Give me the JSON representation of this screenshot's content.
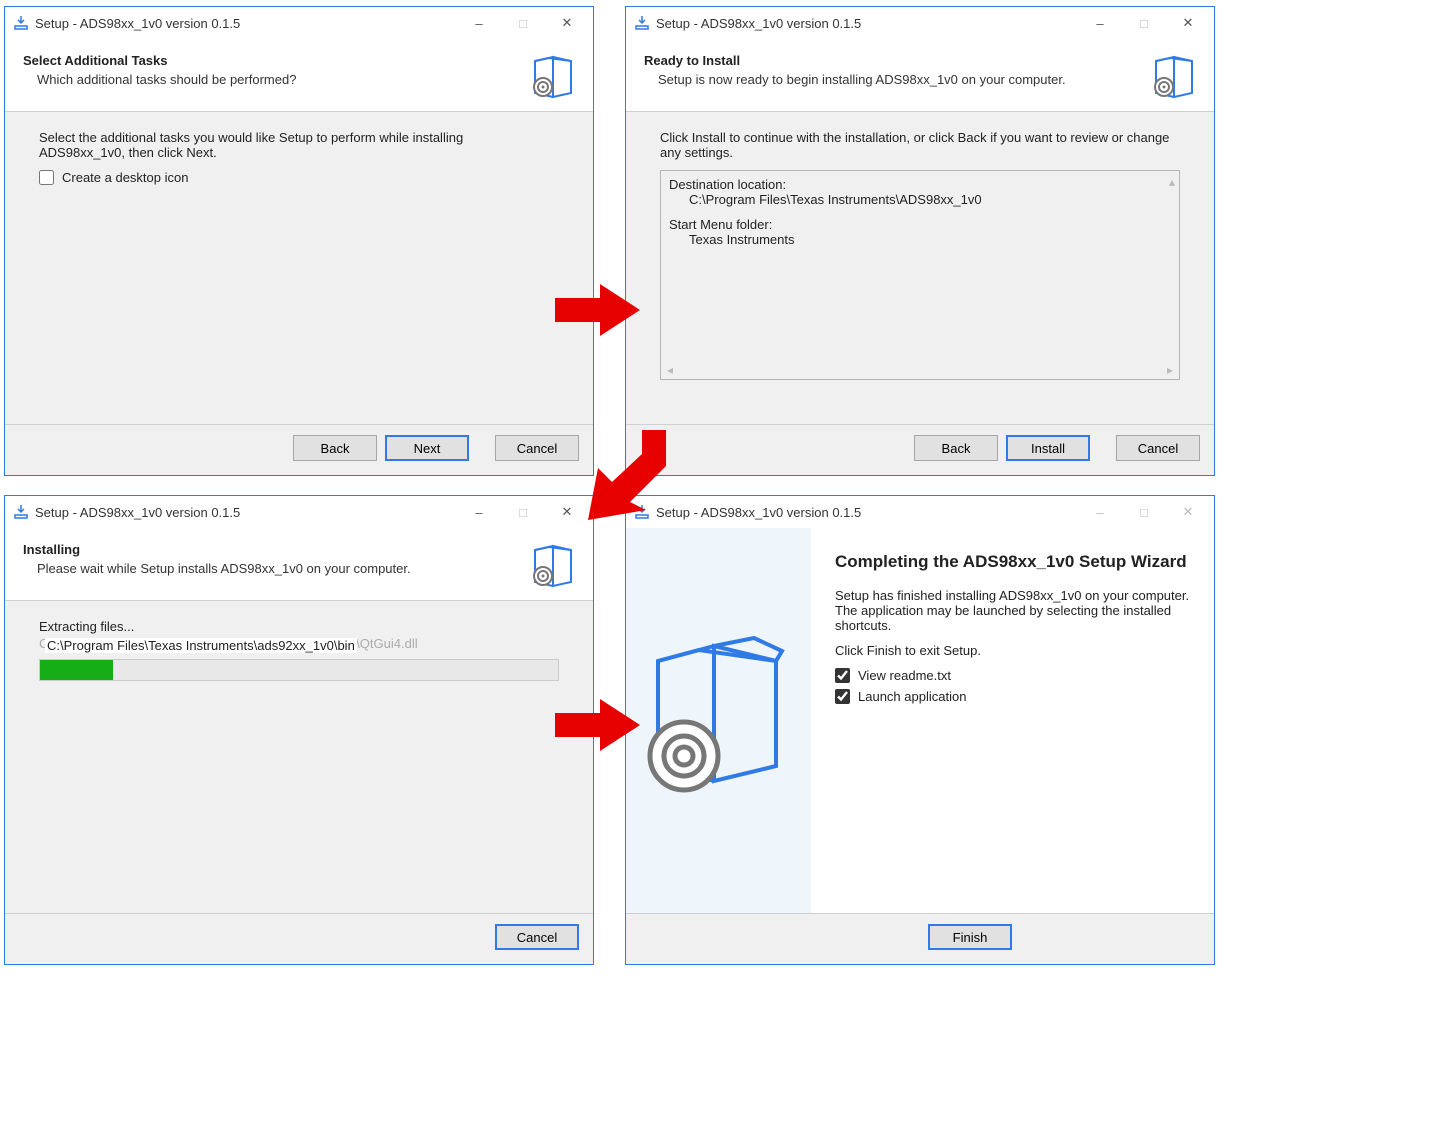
{
  "common": {
    "app_title": "Setup - ADS98xx_1v0 version 0.1.5"
  },
  "dlg1": {
    "heading": "Select Additional Tasks",
    "sub": "Which additional tasks should be performed?",
    "instr": "Select the additional tasks you would like Setup to perform while installing ADS98xx_1v0, then click Next.",
    "checkbox": "Create a desktop icon",
    "back": "Back",
    "next": "Next",
    "cancel": "Cancel"
  },
  "dlg2": {
    "heading": "Ready to Install",
    "sub": "Setup is now ready to begin installing ADS98xx_1v0 on your computer.",
    "instr": "Click Install to continue with the installation, or click Back if you want to review or change any settings.",
    "dest_label": "Destination location:",
    "dest_value": "C:\\Program Files\\Texas Instruments\\ADS98xx_1v0",
    "start_label": "Start Menu folder:",
    "start_value": "Texas Instruments",
    "back": "Back",
    "install": "Install",
    "cancel": "Cancel"
  },
  "dlg3": {
    "heading": "Installing",
    "sub": "Please wait while Setup installs ADS98xx_1v0 on your computer.",
    "status": "Extracting files...",
    "path_bg": "C:\\Program Files\\Texas Instruments\\ADS98xx_1 v0\\bin\\QtGui4.dll",
    "path_overlay": "C:\\Program Files\\Texas Instruments\\ads92xx_1v0\\bin",
    "cancel": "Cancel"
  },
  "dlg4": {
    "title": "Completing the ADS98xx_1v0 Setup Wizard",
    "line1": "Setup has finished installing ADS98xx_1v0 on your computer. The application may be launched by selecting the installed shortcuts.",
    "line2": "Click Finish to exit Setup.",
    "opt1": "View readme.txt",
    "opt2": "Launch application",
    "finish": "Finish"
  }
}
